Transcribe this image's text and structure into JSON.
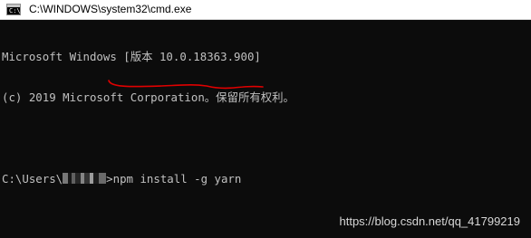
{
  "window": {
    "title": "C:\\WINDOWS\\system32\\cmd.exe",
    "icon": "cmd-console-icon"
  },
  "console": {
    "line1": "Microsoft Windows [版本 10.0.18363.900]",
    "line2": "(c) 2019 Microsoft Corporation。保留所有权利。",
    "prompt_prefix": "C:\\Users\\",
    "prompt_suffix": ">",
    "command": "npm install -g yarn"
  },
  "annotation": {
    "underline_color": "#e00000"
  },
  "watermark": {
    "text": "https://blog.csdn.net/qq_41799219"
  }
}
